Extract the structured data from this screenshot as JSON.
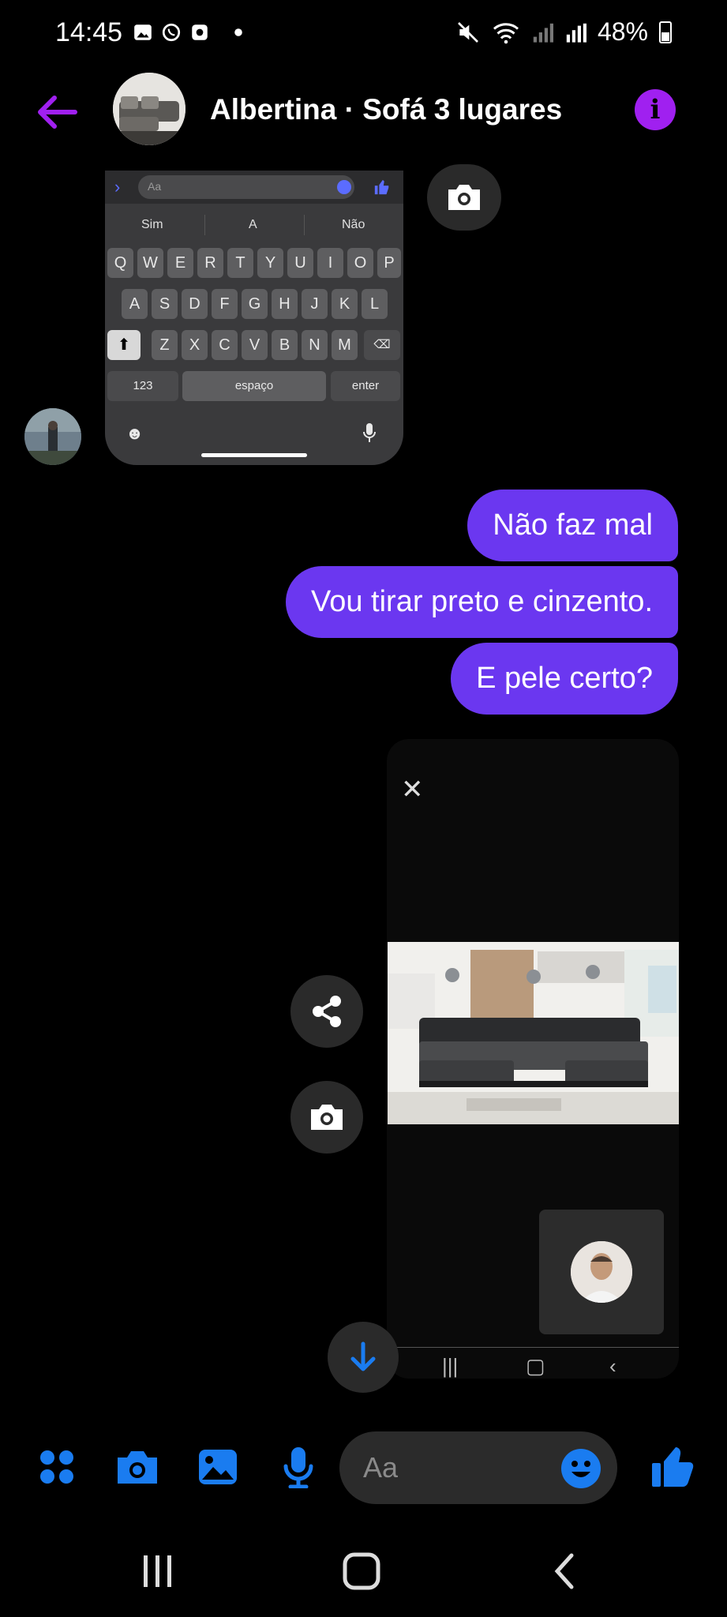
{
  "status_bar": {
    "time": "14:45",
    "battery": "48%"
  },
  "header": {
    "contact_name": "Albertina · Sofá 3 lugares"
  },
  "received_screenshot": {
    "input_placeholder": "Aa",
    "suggestions": [
      "Sim",
      "A",
      "Não"
    ],
    "row1": [
      "Q",
      "W",
      "E",
      "R",
      "T",
      "Y",
      "U",
      "I",
      "O",
      "P"
    ],
    "row2": [
      "A",
      "S",
      "D",
      "F",
      "G",
      "H",
      "J",
      "K",
      "L"
    ],
    "row3": [
      "Z",
      "X",
      "C",
      "V",
      "B",
      "N",
      "M"
    ],
    "key_123": "123",
    "key_space": "espaço",
    "key_enter": "enter"
  },
  "messages": [
    {
      "text": "Não faz mal"
    },
    {
      "text": "Vou tirar preto e cinzento."
    },
    {
      "text": "E pele certo?"
    }
  ],
  "composer": {
    "placeholder": "Aa"
  },
  "colors": {
    "accent": "#6b37f0",
    "header_accent": "#a020f0",
    "messenger_blue": "#1a7cf0"
  }
}
